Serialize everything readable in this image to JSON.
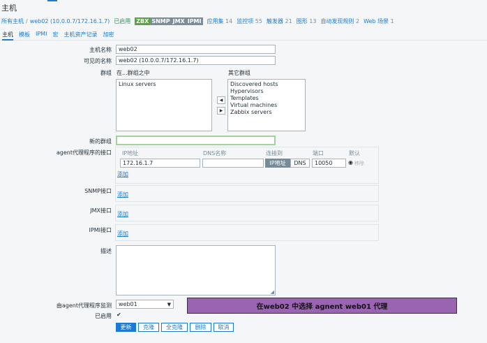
{
  "page": {
    "title": "主机"
  },
  "breadcrumb": {
    "all_hosts": "所有主机",
    "sep": "/",
    "current": "web02 (10.0.0.7/172.16.1.7)",
    "status": "已启用",
    "badges": [
      "ZBX",
      "SNMP",
      "JMX",
      "IPMI"
    ],
    "links": [
      {
        "label": "应用集",
        "count": "14"
      },
      {
        "label": "监控项",
        "count": "55"
      },
      {
        "label": "触发器",
        "count": "21"
      },
      {
        "label": "图形",
        "count": "13"
      },
      {
        "label": "自动发现规则",
        "count": "2"
      },
      {
        "label": "Web 场景",
        "count": "1"
      }
    ]
  },
  "tabs": [
    "主机",
    "模板",
    "IPMI",
    "宏",
    "主机资产记录",
    "加密"
  ],
  "form": {
    "host_name_label": "主机名称",
    "host_name_value": "web02",
    "visible_name_label": "可见的名称",
    "visible_name_value": "web02 (10.0.0.7/172.16.1.7)",
    "groups_label": "群组",
    "in_groups_label": "在...群组之中",
    "other_groups_label": "其它群组",
    "in_groups": [
      "Linux servers"
    ],
    "other_groups": [
      "Discovered hosts",
      "Hypervisors",
      "Templates",
      "Virtual machines",
      "Zabbix servers"
    ],
    "new_group_label": "新的群组",
    "new_group_value": "",
    "agent_label": "agent代理程序的接口",
    "iface_headers": {
      "ip": "IP地址",
      "dns": "DNS名称",
      "connect": "连接到",
      "port": "端口",
      "default": "默认"
    },
    "agent_ip": "172.16.1.7",
    "agent_dns": "",
    "connect_ip": "IP地址",
    "connect_dns": "DNS",
    "agent_port": "10050",
    "remove": "移除",
    "add": "添加",
    "snmp_label": "SNMP接口",
    "jmx_label": "JMX接口",
    "ipmi_label": "IPMI接口",
    "description_label": "描述",
    "proxy_label": "由agent代理程序监测",
    "proxy_value": "web01",
    "enabled_label": "已启用",
    "enabled_check": "✔"
  },
  "buttons": {
    "update": "更新",
    "clone": "克隆",
    "full_clone": "全克隆",
    "delete": "删除",
    "cancel": "取消"
  },
  "annotation": "在web02 中选择 agnent web01 代理",
  "colors": {
    "accent": "#1a7ad5",
    "enabled": "#2e8b57",
    "zbx": "#59a340",
    "annotation": "#9b64b2"
  }
}
